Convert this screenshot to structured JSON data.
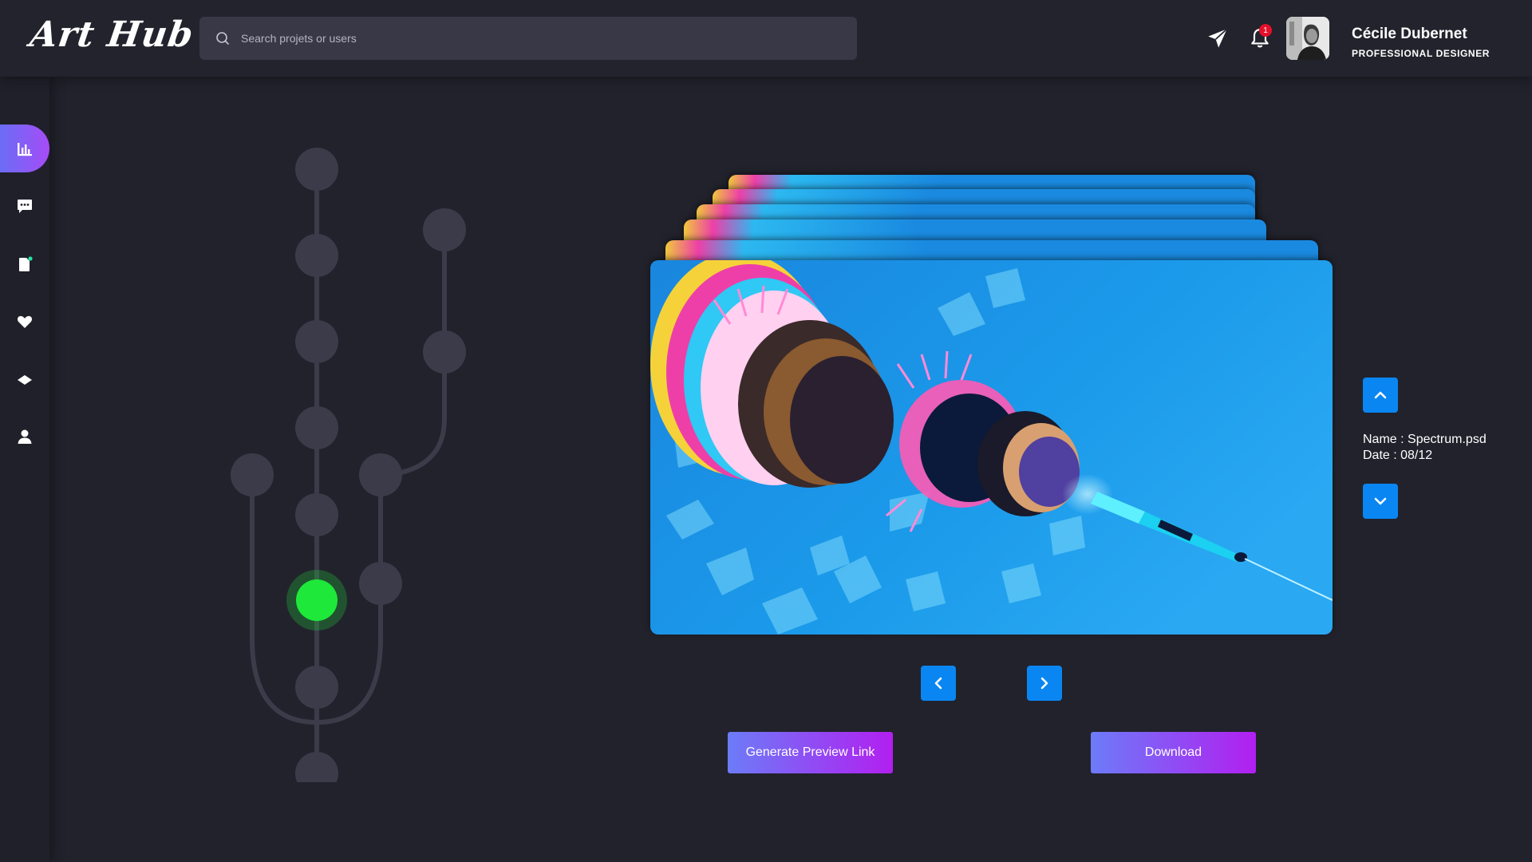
{
  "app": {
    "logo": "Art Hub"
  },
  "header": {
    "search_placeholder": "Search projets or users",
    "notification_count": "1",
    "user_name": "Cécile Dubernet",
    "user_role": "PROFESSIONAL DESIGNER"
  },
  "sidebar": {
    "items": [
      {
        "icon": "chart-icon",
        "active": true
      },
      {
        "icon": "chat-icon"
      },
      {
        "icon": "file-icon"
      },
      {
        "icon": "heart-icon"
      },
      {
        "icon": "layers-icon"
      },
      {
        "icon": "user-icon"
      }
    ]
  },
  "preview": {
    "name_text": "Name : Spectrum.psd",
    "date_text": "Date : 08/12"
  },
  "actions": {
    "generate_label": "Generate Preview Link",
    "download_label": "Download"
  },
  "colors": {
    "accent": "#0a86f2",
    "active_node": "#1ee83a",
    "gradient_start": "#6c7cf8",
    "gradient_end": "#b21ff0"
  }
}
